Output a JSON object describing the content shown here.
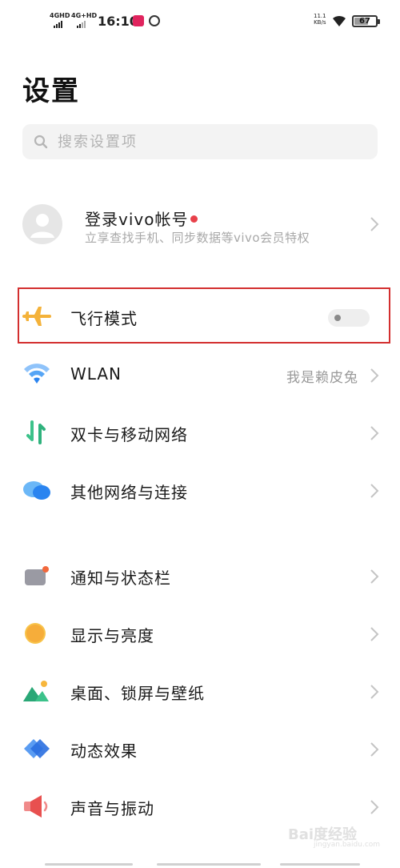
{
  "status_bar": {
    "sim1": "4GHD",
    "sim2": "4G+HD",
    "time": "16:10",
    "net_speed_value": "11.1",
    "net_speed_unit": "KB/s",
    "battery": "67"
  },
  "page": {
    "title": "设置"
  },
  "search": {
    "placeholder": "搜索设置项"
  },
  "account": {
    "title": "登录vivo帐号",
    "subtitle": "立享查找手机、同步数据等vivo会员特权"
  },
  "settings": [
    {
      "label": "飞行模式",
      "icon": "airplane-icon",
      "control": "toggle",
      "checked": false
    },
    {
      "label": "WLAN",
      "icon": "wifi-icon",
      "value": "我是赖皮兔"
    },
    {
      "label": "双卡与移动网络",
      "icon": "mobile-network-icon"
    },
    {
      "label": "其他网络与连接",
      "icon": "cloud-connection-icon"
    },
    {
      "label": "通知与状态栏",
      "icon": "notification-icon"
    },
    {
      "label": "显示与亮度",
      "icon": "brightness-icon"
    },
    {
      "label": "桌面、锁屏与壁纸",
      "icon": "wallpaper-icon"
    },
    {
      "label": "动态效果",
      "icon": "animation-icon"
    },
    {
      "label": "声音与振动",
      "icon": "sound-icon"
    }
  ],
  "colors": {
    "highlight_border": "#d32f2f",
    "airplane": "#f4b23a",
    "wifi": "#2a84f0",
    "notification_dot": "#e8414a"
  },
  "watermark": {
    "brand": "Bai度经验",
    "url": "jingyan.baidu.com"
  }
}
